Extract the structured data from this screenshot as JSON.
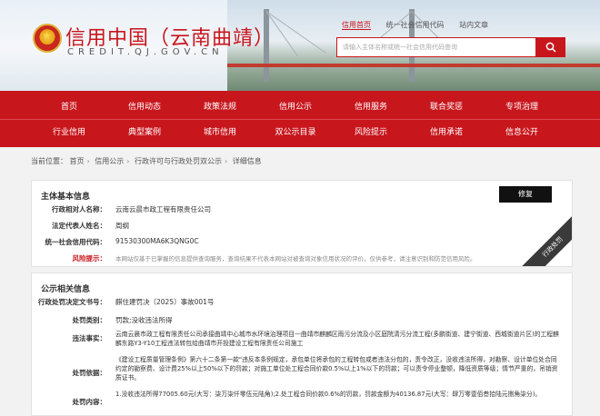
{
  "header": {
    "title": "信用中国（云南曲靖）",
    "subtitle": "CREDIT.QJ.GOV.CN",
    "top_links": [
      "信用首页",
      "统一社会信用代码",
      "站内文章"
    ],
    "search_placeholder": "请输入主体名称或统一社会信用代码查询",
    "brand_color": "#c8161d"
  },
  "nav": {
    "row1": [
      "首页",
      "信用动态",
      "政策法规",
      "信用公示",
      "信用服务",
      "联合奖惩",
      "专项治理"
    ],
    "row2": [
      "行业信用",
      "典型案例",
      "城市信用",
      "双公示目录",
      "风险提示",
      "信用承诺",
      "信息公开"
    ]
  },
  "breadcrumb": {
    "prefix": "当前位置：",
    "items": [
      "首页",
      "信用公示",
      "行政许可与行政处罚双公示",
      "详细信息"
    ]
  },
  "basic": {
    "title": "主体基本信息",
    "repair_label": "修复",
    "ribbon": "行政处罚",
    "rows": [
      {
        "label": "行政相对人名称：",
        "value": "云南云晨市政工程有限责任公司"
      },
      {
        "label": "法定代表人姓名：",
        "value": "周纲"
      },
      {
        "label": "统一社会信用代码：",
        "value": "91530300MA6K3QNG0C"
      },
      {
        "label": "风险提示：",
        "value": "本网站仅基于已掌握的信息提供查询服务，查询结果不代表本网站对被查询对象信用状况的评价，仅供参考，请注意识别和防范信用风险。"
      }
    ]
  },
  "publicity": {
    "title": "公示相关信息",
    "rows": [
      {
        "label": "行政处罚决定文书号：",
        "value": "麒住建罚决〔2025〕事故001号"
      },
      {
        "label": "处罚类别：",
        "value": "罚款;没收违法所得"
      },
      {
        "label": "违法事实：",
        "value": "云南云晨市政工程有限责任公司承接曲靖中心城市水环境治理项目—曲靖市麒麟区雨污分流及小区庭院清污分流工程(多鹏街道、建宁街道、西城街道片区)的工程麒麟东路Y3-Y10工程违法转包给曲靖市开投建设工程有限责任公司施工"
      },
      {
        "label": "处罚依据：",
        "value": "《建设工程质量管理条例》第六十二条第一款\"违反本条例规定，承包单位将承包的工程转包或者违法分包的，责令改正，没收违法所得，对勘察、设计单位处合同约定的勘察费、设计费25%以上50%以下的罚款；对施工单位处工程合同价款0.5%以上1%以下的罚款；可以责令停业整顿，降低资质等级；情节严重的，吊销资质证书。"
      },
      {
        "label": "处罚内容：",
        "value": "1.没收违法所得77005.60元(大写：柒万柒仟零伍元陆角);2.处工程合同价款0.6%的罚款，罚款金额为40136.87元(大写：肆万零壹佰叁拾陆元捌角柒分)。"
      }
    ]
  }
}
